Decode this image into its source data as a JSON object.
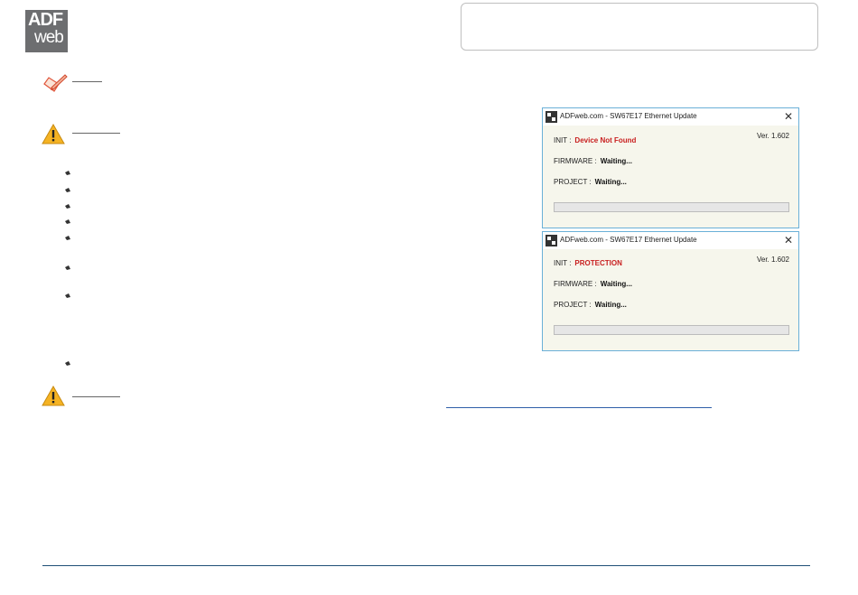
{
  "logo": {
    "line1": "ADF",
    "line2": "web"
  },
  "icons": {
    "note": "note-pencil-icon",
    "warning": "warning-triangle-icon",
    "bullet": "bullet-arrow-icon"
  },
  "windows": [
    {
      "title": "ADFweb.com - SW67E17 Ethernet Update",
      "version": "Ver. 1.602",
      "init_label": "INIT :",
      "init_value": "Device Not Found",
      "firmware_label": "FIRMWARE :",
      "firmware_value": "Waiting...",
      "project_label": "PROJECT :",
      "project_value": "Waiting...",
      "progress": 0
    },
    {
      "title": "ADFweb.com - SW67E17 Ethernet Update",
      "version": "Ver. 1.602",
      "init_label": "INIT :",
      "init_value": "PROTECTION",
      "firmware_label": "FIRMWARE :",
      "firmware_value": "Waiting...",
      "project_label": "PROJECT :",
      "project_value": "Waiting...",
      "progress": 0
    }
  ],
  "colors": {
    "error_text": "#c81e1e",
    "window_border": "#6ab0d8",
    "window_bg": "#f6f6ec",
    "footer_rule": "#1f4f77",
    "link": "#2f5fa8"
  }
}
